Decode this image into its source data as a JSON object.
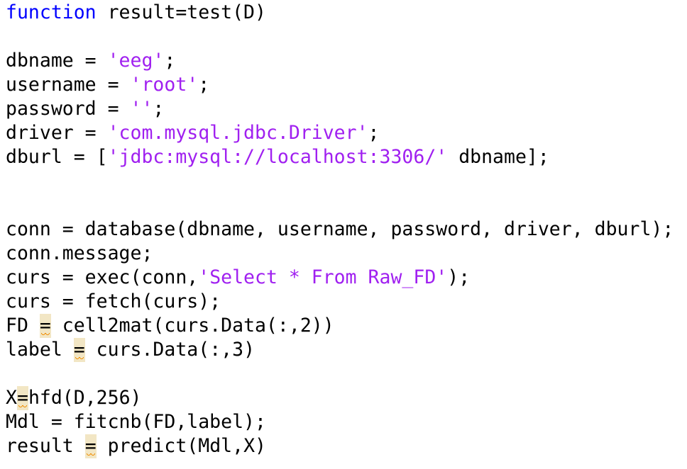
{
  "editor": {
    "lines": [
      {
        "segments": [
          {
            "t": "function",
            "c": "kw"
          },
          {
            "t": " result=test(D)"
          }
        ]
      },
      {
        "segments": []
      },
      {
        "segments": [
          {
            "t": "dbname = "
          },
          {
            "t": "'eeg'",
            "c": "str"
          },
          {
            "t": ";"
          }
        ]
      },
      {
        "segments": [
          {
            "t": "username = "
          },
          {
            "t": "'root'",
            "c": "str"
          },
          {
            "t": ";"
          }
        ]
      },
      {
        "segments": [
          {
            "t": "password = "
          },
          {
            "t": "''",
            "c": "str"
          },
          {
            "t": ";"
          }
        ]
      },
      {
        "segments": [
          {
            "t": "driver = "
          },
          {
            "t": "'com.mysql.jdbc.Driver'",
            "c": "str"
          },
          {
            "t": ";"
          }
        ]
      },
      {
        "segments": [
          {
            "t": "dburl = ["
          },
          {
            "t": "'jdbc:mysql://localhost:3306/'",
            "c": "str"
          },
          {
            "t": " dbname];"
          }
        ]
      },
      {
        "segments": []
      },
      {
        "segments": []
      },
      {
        "segments": [
          {
            "t": "conn = database(dbname, username, password, driver, dburl);"
          }
        ]
      },
      {
        "segments": [
          {
            "t": "conn.message;"
          }
        ]
      },
      {
        "segments": [
          {
            "t": "curs = exec(conn,"
          },
          {
            "t": "'Select * From Raw_FD'",
            "c": "str"
          },
          {
            "t": ");"
          }
        ]
      },
      {
        "segments": [
          {
            "t": "curs = fetch(curs);"
          }
        ]
      },
      {
        "segments": [
          {
            "t": "FD "
          },
          {
            "t": "=",
            "c": "warn"
          },
          {
            "t": " cell2mat(curs.Data(:,2))"
          }
        ]
      },
      {
        "segments": [
          {
            "t": "label "
          },
          {
            "t": "=",
            "c": "warn"
          },
          {
            "t": " curs.Data(:,3)"
          }
        ]
      },
      {
        "segments": []
      },
      {
        "segments": [
          {
            "t": "X"
          },
          {
            "t": "=",
            "c": "warn"
          },
          {
            "t": "hfd(D,256)"
          }
        ]
      },
      {
        "segments": [
          {
            "t": "Mdl = fitcnb(FD,label);"
          }
        ]
      },
      {
        "segments": [
          {
            "t": "result "
          },
          {
            "t": "=",
            "c": "warn"
          },
          {
            "t": " predict(Mdl,X)"
          }
        ]
      }
    ],
    "colors": {
      "keyword": "#0000ff",
      "string": "#a020f0",
      "warning_highlight": "#f2e6c4",
      "warning_underline": "#f08c00",
      "text": "#000000",
      "background": "#ffffff"
    }
  }
}
